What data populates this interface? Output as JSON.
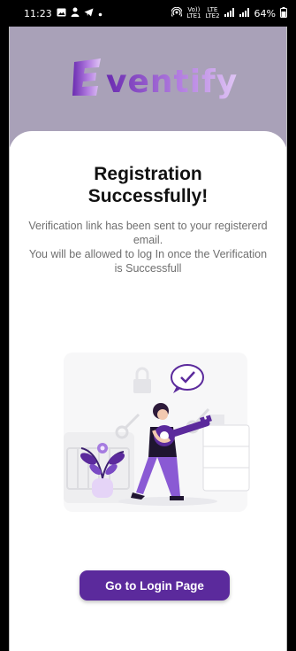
{
  "status_bar": {
    "time": "11:23",
    "lte_top": "Vo))",
    "lte_bottom": "LTE1",
    "lte2_top": "LTE",
    "lte2_bottom": "LTE2",
    "battery": "64%"
  },
  "header": {
    "logo_text": "Eventify"
  },
  "card": {
    "title": "Registration Successfully!",
    "message_line1": "Verification link has been sent to your registererd email.",
    "message_line2": "You will be allowed to log In once the Verification is Successfull",
    "button_label": "Go to Login Page"
  },
  "colors": {
    "header_bg": "#a9a1b8",
    "accent": "#5b2a9c",
    "logo_gradient_start": "#6a2bb0",
    "logo_gradient_end": "#e0c6f5"
  }
}
